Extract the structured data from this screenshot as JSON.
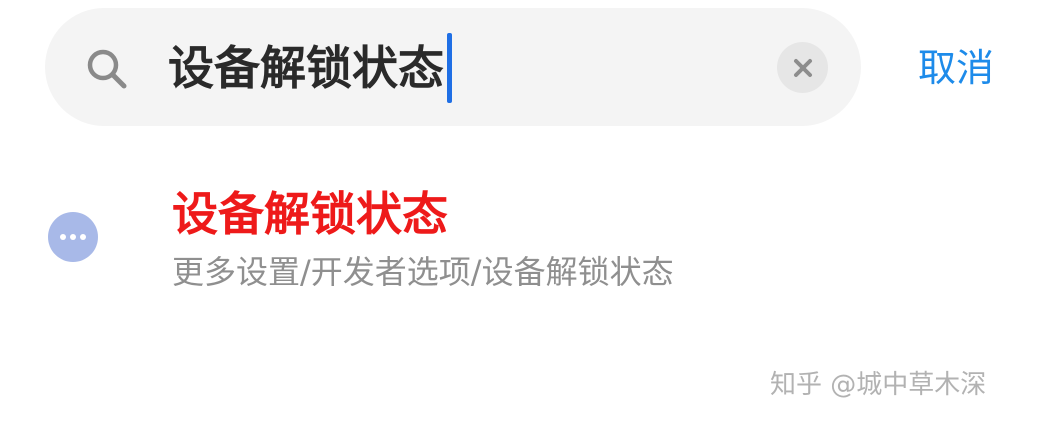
{
  "search": {
    "value": "设备解锁状态",
    "icon": "search-icon",
    "clear_icon": "close-icon",
    "cancel_label": "取消"
  },
  "results": [
    {
      "icon": "more-icon",
      "title": "设备解锁状态",
      "path": "更多设置/开发者选项/设备解锁状态"
    }
  ],
  "watermark": {
    "text": "知乎 @城中草木深"
  },
  "colors": {
    "search_bg": "#f4f4f4",
    "caret": "#1f6fe5",
    "cancel": "#1d8bea",
    "result_title": "#ee1a1a",
    "result_path": "#8f8f8f",
    "result_icon_bg": "#a8b9e8"
  }
}
